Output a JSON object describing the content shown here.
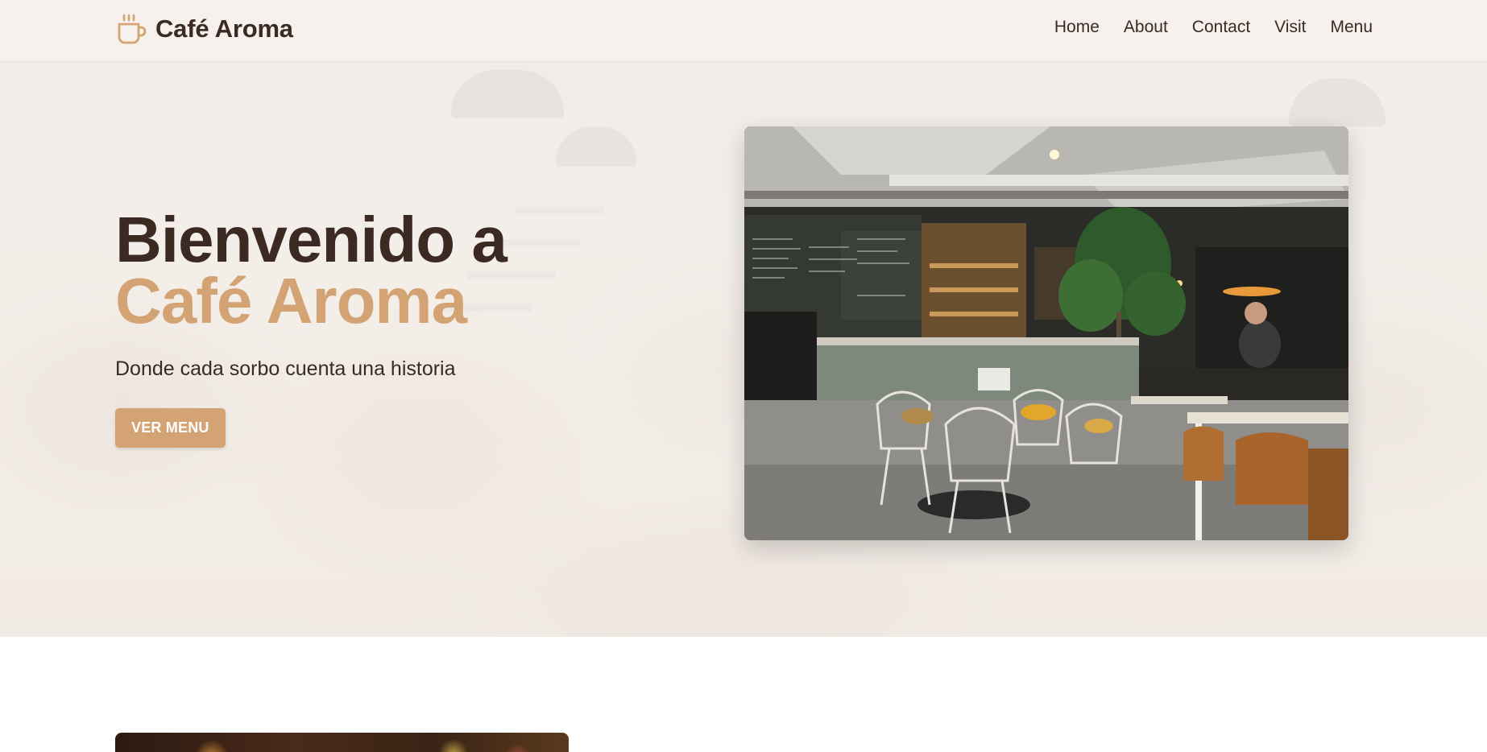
{
  "brand": {
    "name": "Café Aroma",
    "icon": "coffee-cup-icon",
    "accent_color": "#d4a373",
    "text_color": "#3b2a22"
  },
  "nav": {
    "items": [
      {
        "label": "Home"
      },
      {
        "label": "About"
      },
      {
        "label": "Contact"
      },
      {
        "label": "Visit"
      },
      {
        "label": "Menu"
      }
    ]
  },
  "hero": {
    "title_line1": "Bienvenido a",
    "title_line2": "Café Aroma",
    "subtitle": "Donde cada sorbo cuenta una historia",
    "cta_label": "VER MENU"
  }
}
